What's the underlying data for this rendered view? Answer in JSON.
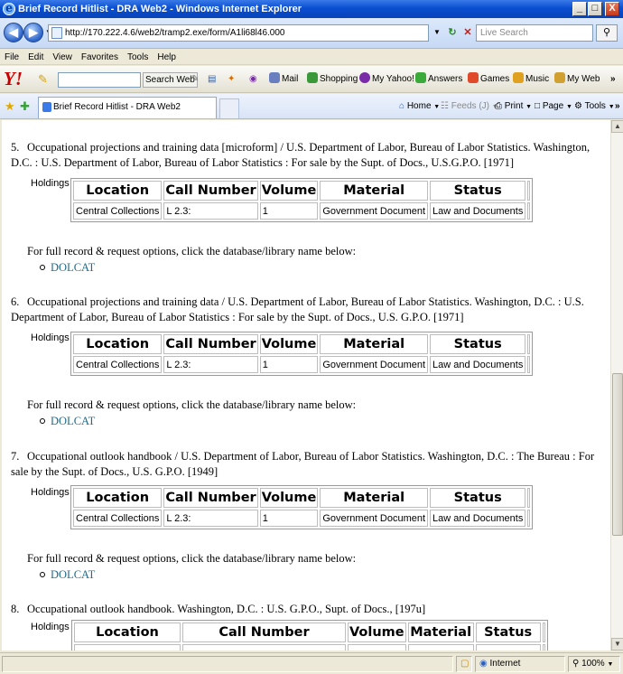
{
  "window": {
    "title": "Brief Record Hitlist - DRA Web2 - Windows Internet Explorer",
    "min_label": "_",
    "max_label": "□",
    "close_label": "X"
  },
  "address": {
    "url": "http://170.222.4.6/web2/tramp2.exe/form/A1li68l46.000",
    "search_placeholder": "Live Search"
  },
  "menu": [
    "File",
    "Edit",
    "View",
    "Favorites",
    "Tools",
    "Help"
  ],
  "yahoo_toolbar": {
    "logo": "Y!",
    "search_button": "Search Web",
    "items": [
      "Mail",
      "Shopping",
      "My Yahoo!",
      "Answers",
      "Games",
      "Music",
      "My Web"
    ],
    "more": "»"
  },
  "tab": {
    "title": "Brief Record Hitlist - DRA Web2"
  },
  "commands": {
    "home": "Home",
    "feeds": "Feeds (J)",
    "print": "Print",
    "page": "Page",
    "tools": "Tools",
    "more": "»"
  },
  "holdings_label": "Holdings :",
  "table_headers": [
    "Location",
    "Call Number",
    "Volume",
    "Material",
    "Status"
  ],
  "note_text": "For full record & request options, click the database/library name below:",
  "db_link": "DOLCAT",
  "records": [
    {
      "num": "5.",
      "citation": "Occupational projections and training data [microform] / U.S. Department of Labor, Bureau of Labor Statistics. Washington, D.C. : U.S. Department of Labor, Bureau of Labor Statistics : For sale by the Supt. of Docs., U.S.G.P.O. [1971]",
      "row": [
        "Central Collections",
        "L 2.3:",
        "1",
        "Government Document",
        "Law and Documents"
      ]
    },
    {
      "num": "6.",
      "citation": "Occupational projections and training data / U.S. Department of Labor, Bureau of Labor Statistics. Washington, D.C. : U.S. Department of Labor, Bureau of Labor Statistics : For sale by the Supt. of Docs., U.S. G.P.O. [1971]",
      "row": [
        "Central Collections",
        "L 2.3:",
        "1",
        "Government Document",
        "Law and Documents"
      ]
    },
    {
      "num": "7.",
      "citation": "Occupational outlook handbook / U.S. Department of Labor, Bureau of Labor Statistics. Washington, D.C. : The Bureau : For sale by the Supt. of Docs., U.S. G.P.O. [1949]",
      "row": [
        "Central Collections",
        "L 2.3:",
        "1",
        "Government Document",
        "Law and Documents"
      ]
    },
    {
      "num": "8.",
      "citation": "Occupational outlook handbook. Washington, D.C. : U.S. G.P.O., Supt. of Docs., [197u]",
      "row": []
    }
  ],
  "status": {
    "zone": "Internet",
    "zoom": "100%"
  }
}
